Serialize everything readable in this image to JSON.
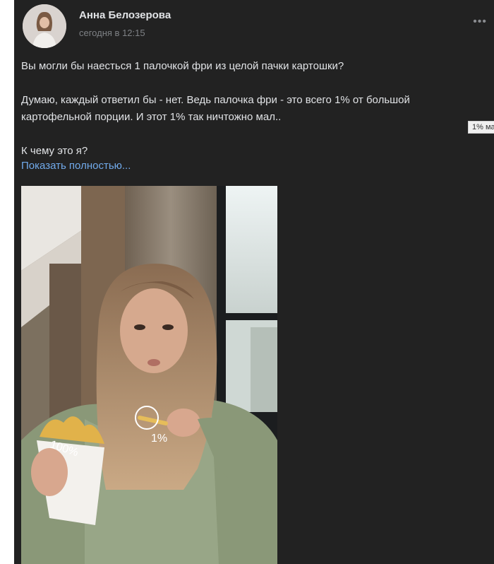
{
  "post": {
    "author": "Анна Белозерова",
    "time": "сегодня в 12:15",
    "more_icon": "more-horizontal-icon",
    "paragraphs": [
      "Вы могли бы наесться 1 палочкой фри из целой пачки картошки?",
      "Думаю, каждый ответил бы - нет. Ведь палочка фри - это всего 1% от большой картофельной порции. И этот 1% так ничтожно мал..",
      "К чему это я?"
    ],
    "show_more": "Показать полностью...",
    "tooltip": "1% ма"
  },
  "photo": {
    "label_100": "100%",
    "label_1": "1%"
  },
  "colors": {
    "background": "#222222",
    "text": "#e1e3e6",
    "muted": "#7e8185",
    "link": "#71aaeb"
  }
}
